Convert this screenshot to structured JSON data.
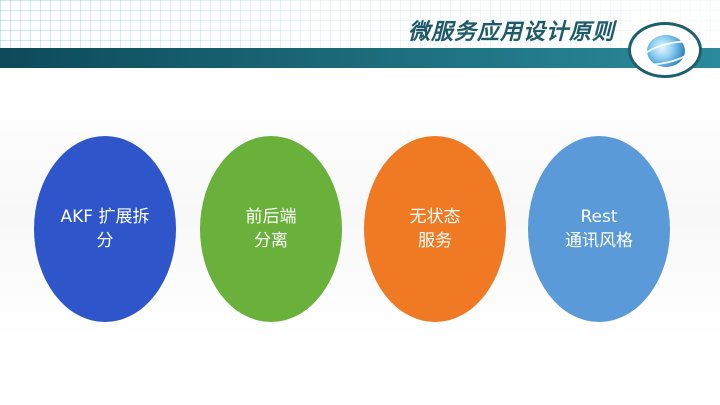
{
  "slide": {
    "title": "微服务应用设计原则"
  },
  "principles": [
    {
      "label": "AKF 扩展拆\n分",
      "color": "#2e55c9"
    },
    {
      "label": "前后端\n分离",
      "color": "#69b13a"
    },
    {
      "label": "无状态\n服务",
      "color": "#ef7a23"
    },
    {
      "label": "Rest\n通讯风格",
      "color": "#5b9ad8"
    }
  ],
  "header": {
    "logo_icon": "globe-icon",
    "band_color": "#1a6878"
  }
}
